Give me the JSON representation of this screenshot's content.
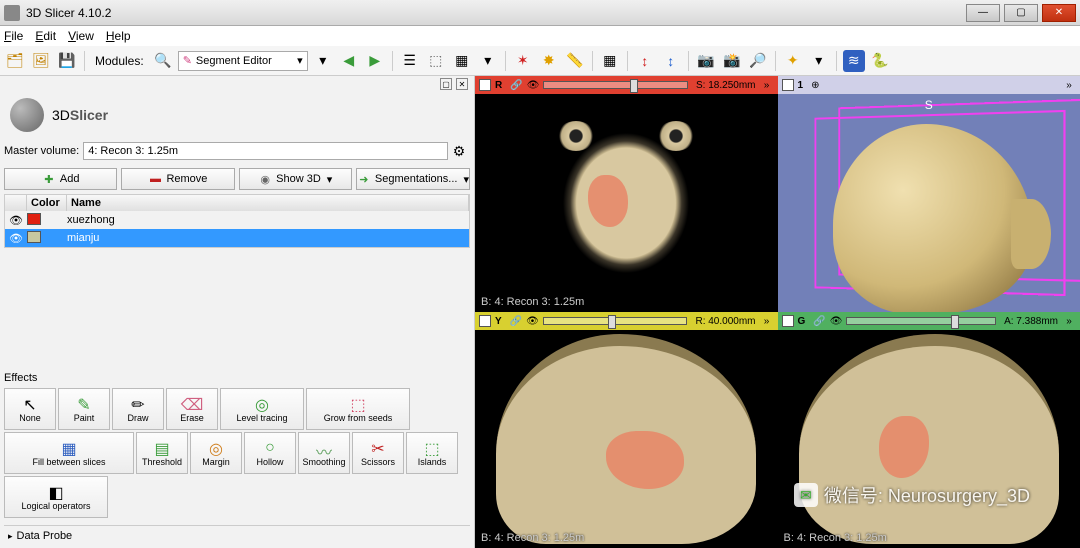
{
  "window": {
    "title": "3D Slicer 4.10.2"
  },
  "menu": {
    "file": "File",
    "edit": "Edit",
    "view": "View",
    "help": "Help"
  },
  "toolbar": {
    "modules_label": "Modules:",
    "module_selected": "Segment Editor"
  },
  "logo": {
    "text_a": "3D",
    "text_b": "Slicer"
  },
  "master_volume": {
    "label": "Master volume:",
    "value": "4: Recon 3: 1.25m"
  },
  "buttons": {
    "add": "Add",
    "remove": "Remove",
    "show3d": "Show 3D",
    "segmentations": "Segmentations..."
  },
  "table": {
    "hdr_color": "Color",
    "hdr_name": "Name",
    "rows": [
      {
        "color": "#e02010",
        "name": "xuezhong",
        "selected": false
      },
      {
        "color": "#c8c8a0",
        "name": "mianju",
        "selected": true
      }
    ]
  },
  "effects_label": "Effects",
  "effects": {
    "none": "None",
    "paint": "Paint",
    "draw": "Draw",
    "erase": "Erase",
    "level": "Level tracing",
    "grow": "Grow from seeds",
    "fill": "Fill between slices",
    "threshold": "Threshold",
    "margin": "Margin",
    "hollow": "Hollow",
    "smoothing": "Smoothing",
    "scissors": "Scissors",
    "islands": "Islands",
    "logical": "Logical operators"
  },
  "dataprobe": "Data Probe",
  "views": {
    "red": {
      "letter": "R",
      "value": "S: 18.250mm",
      "corner": "B: 4: Recon 3: 1.25m"
    },
    "yellow": {
      "letter": "Y",
      "value": "R: 40.000mm",
      "corner": "B: 4: Recon 3: 1.25m"
    },
    "green": {
      "letter": "G",
      "value": "A: 7.388mm",
      "corner": "B: 4: Recon 3: 1.25m"
    },
    "threeD": {
      "letter": "1",
      "s_label": "S"
    }
  },
  "watermark": "微信号: Neurosurgery_3D"
}
